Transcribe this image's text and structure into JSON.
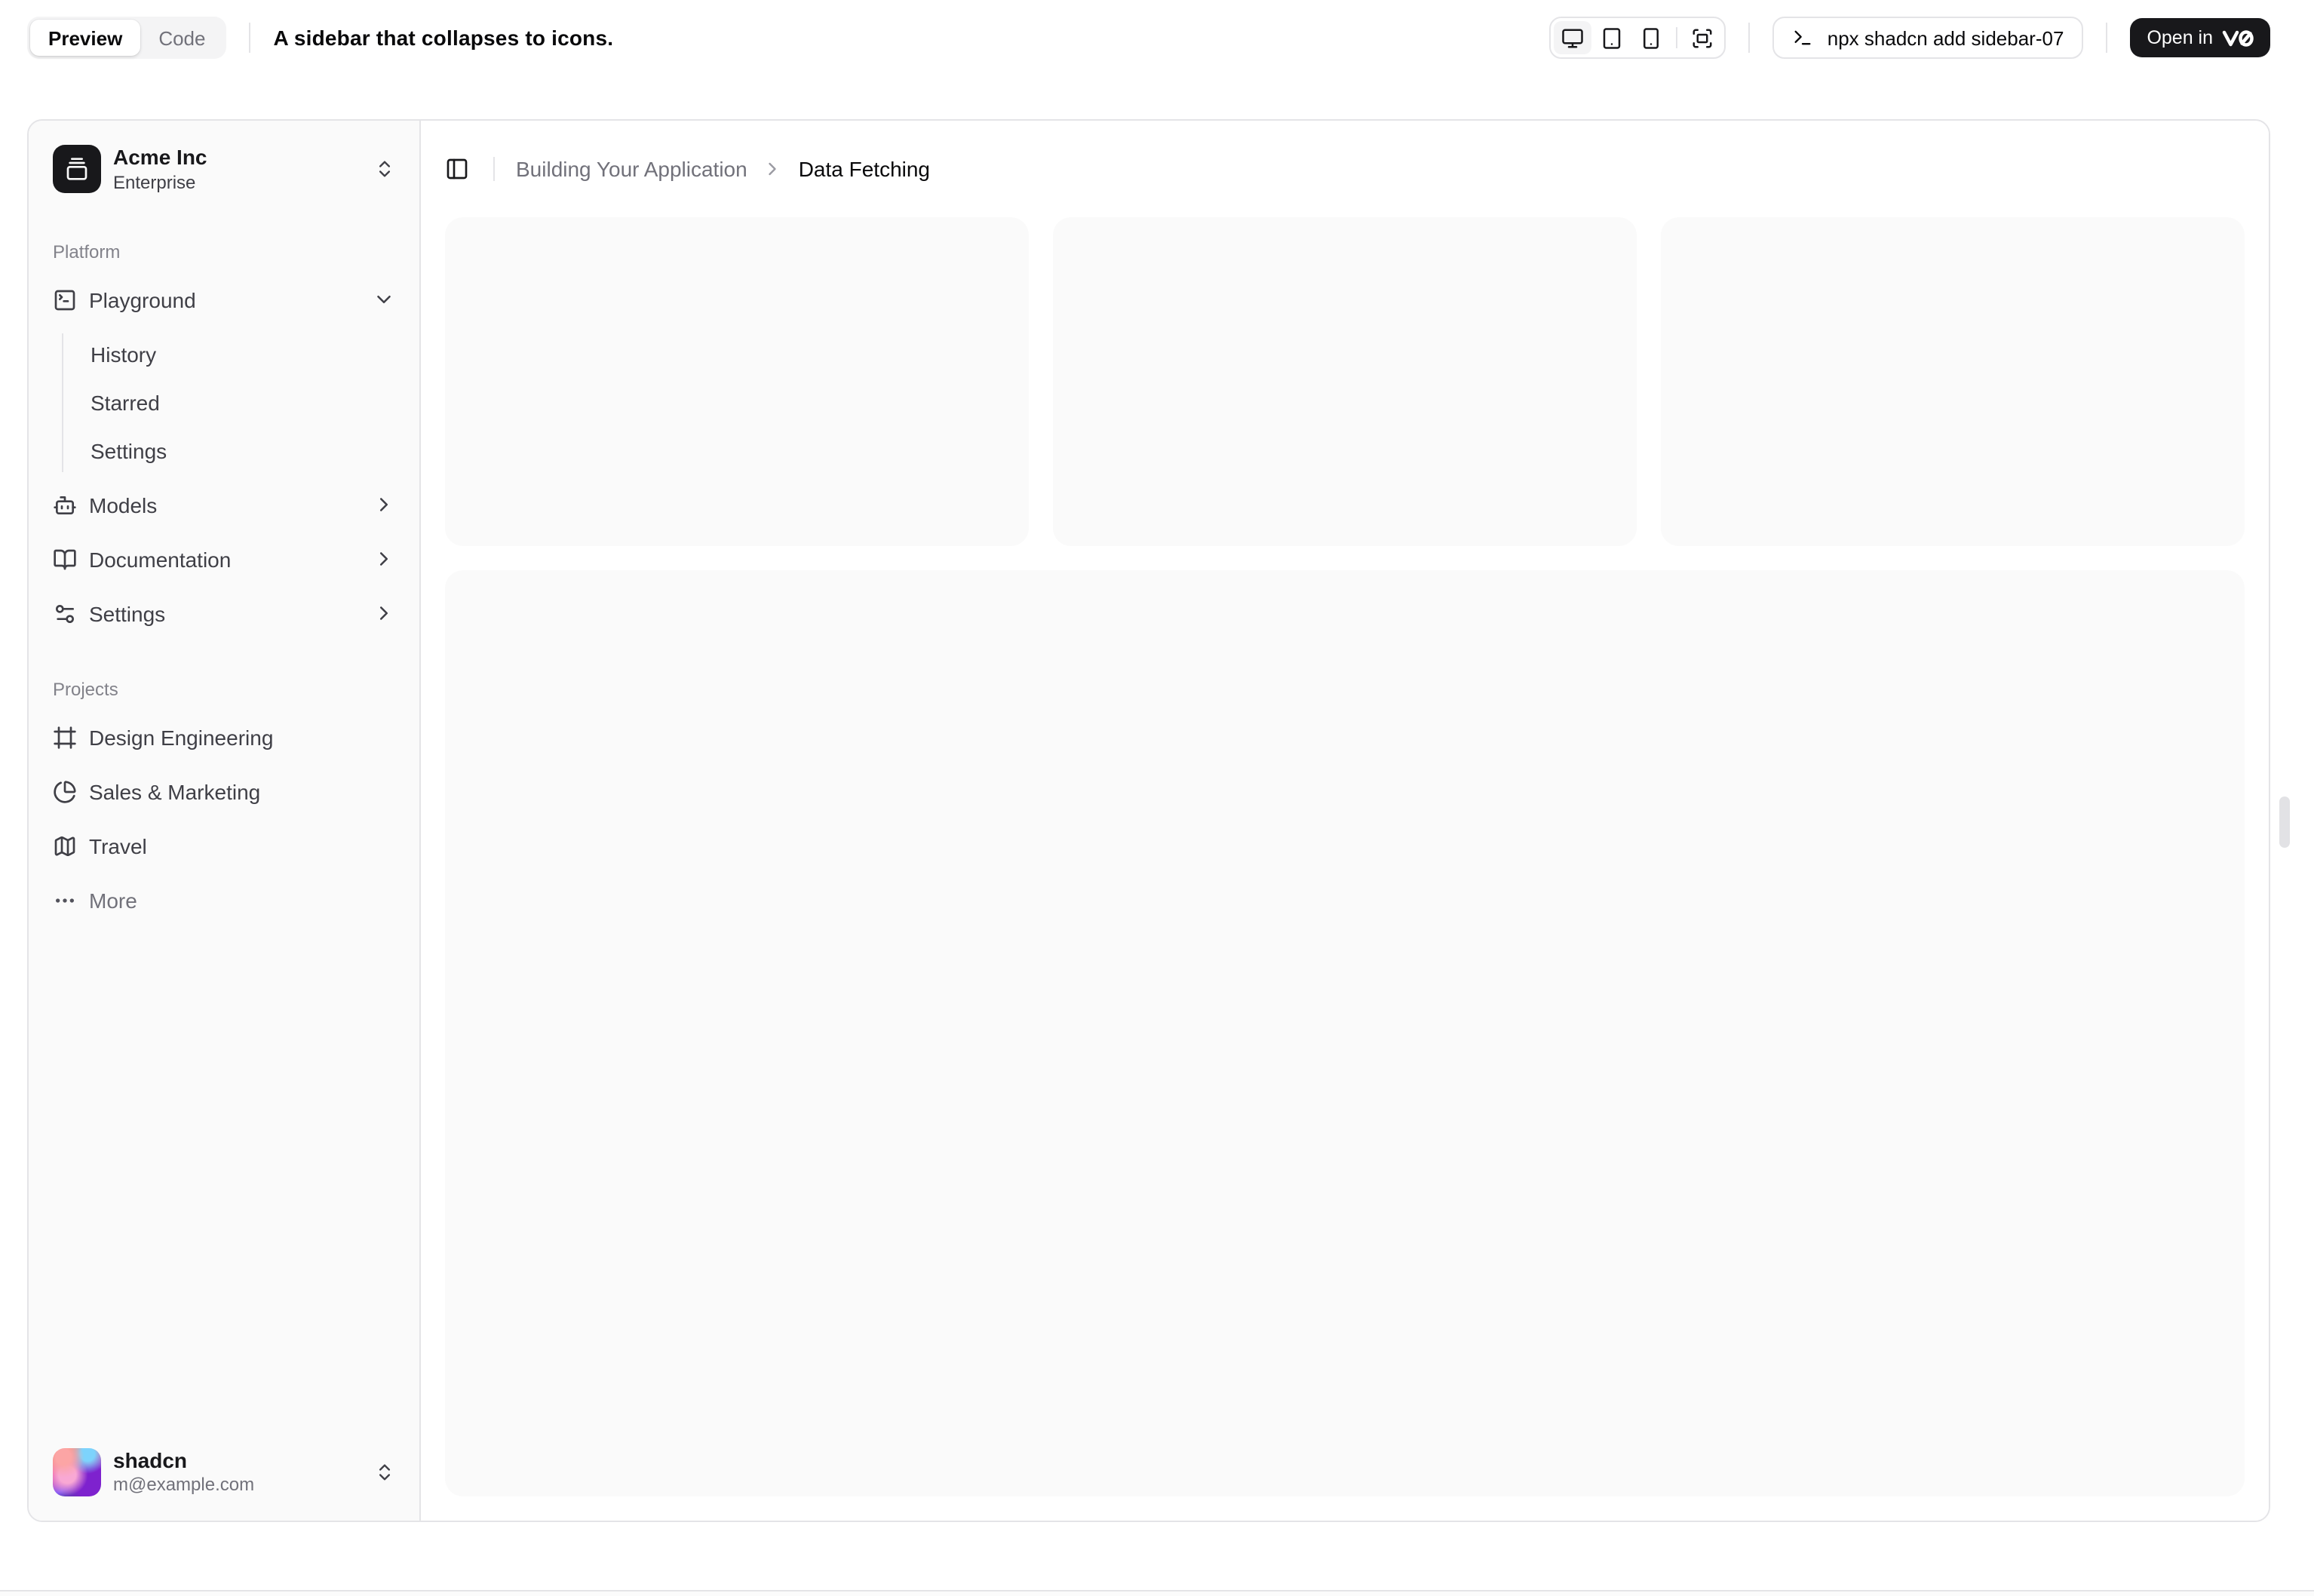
{
  "toolbar": {
    "tabs": [
      {
        "label": "Preview"
      },
      {
        "label": "Code"
      }
    ],
    "title": "A sidebar that collapses to icons.",
    "command": "npx shadcn add sidebar-07",
    "open_in": {
      "label": "Open in",
      "logo": "v0"
    }
  },
  "sidebar": {
    "team": {
      "name": "Acme Inc",
      "plan": "Enterprise"
    },
    "groups": [
      {
        "label": "Platform",
        "items": [
          {
            "label": "Playground",
            "icon": "square-terminal-icon",
            "children": [
              "History",
              "Starred",
              "Settings"
            ]
          },
          {
            "label": "Models",
            "icon": "bot-icon"
          },
          {
            "label": "Documentation",
            "icon": "book-open-icon"
          },
          {
            "label": "Settings",
            "icon": "settings-icon"
          }
        ]
      },
      {
        "label": "Projects",
        "items": [
          {
            "label": "Design Engineering",
            "icon": "frame-icon"
          },
          {
            "label": "Sales & Marketing",
            "icon": "pie-chart-icon"
          },
          {
            "label": "Travel",
            "icon": "map-icon"
          },
          {
            "label": "More",
            "icon": "ellipsis-icon"
          }
        ]
      }
    ],
    "user": {
      "name": "shadcn",
      "email": "m@example.com"
    }
  },
  "breadcrumb": {
    "parent": "Building Your Application",
    "current": "Data Fetching"
  },
  "colors": {
    "accent_dark": "#18181b",
    "border": "#e4e4e7",
    "sidebar_bg": "#fafafa",
    "muted_text": "#71717a",
    "card_bg": "#fafafa"
  }
}
